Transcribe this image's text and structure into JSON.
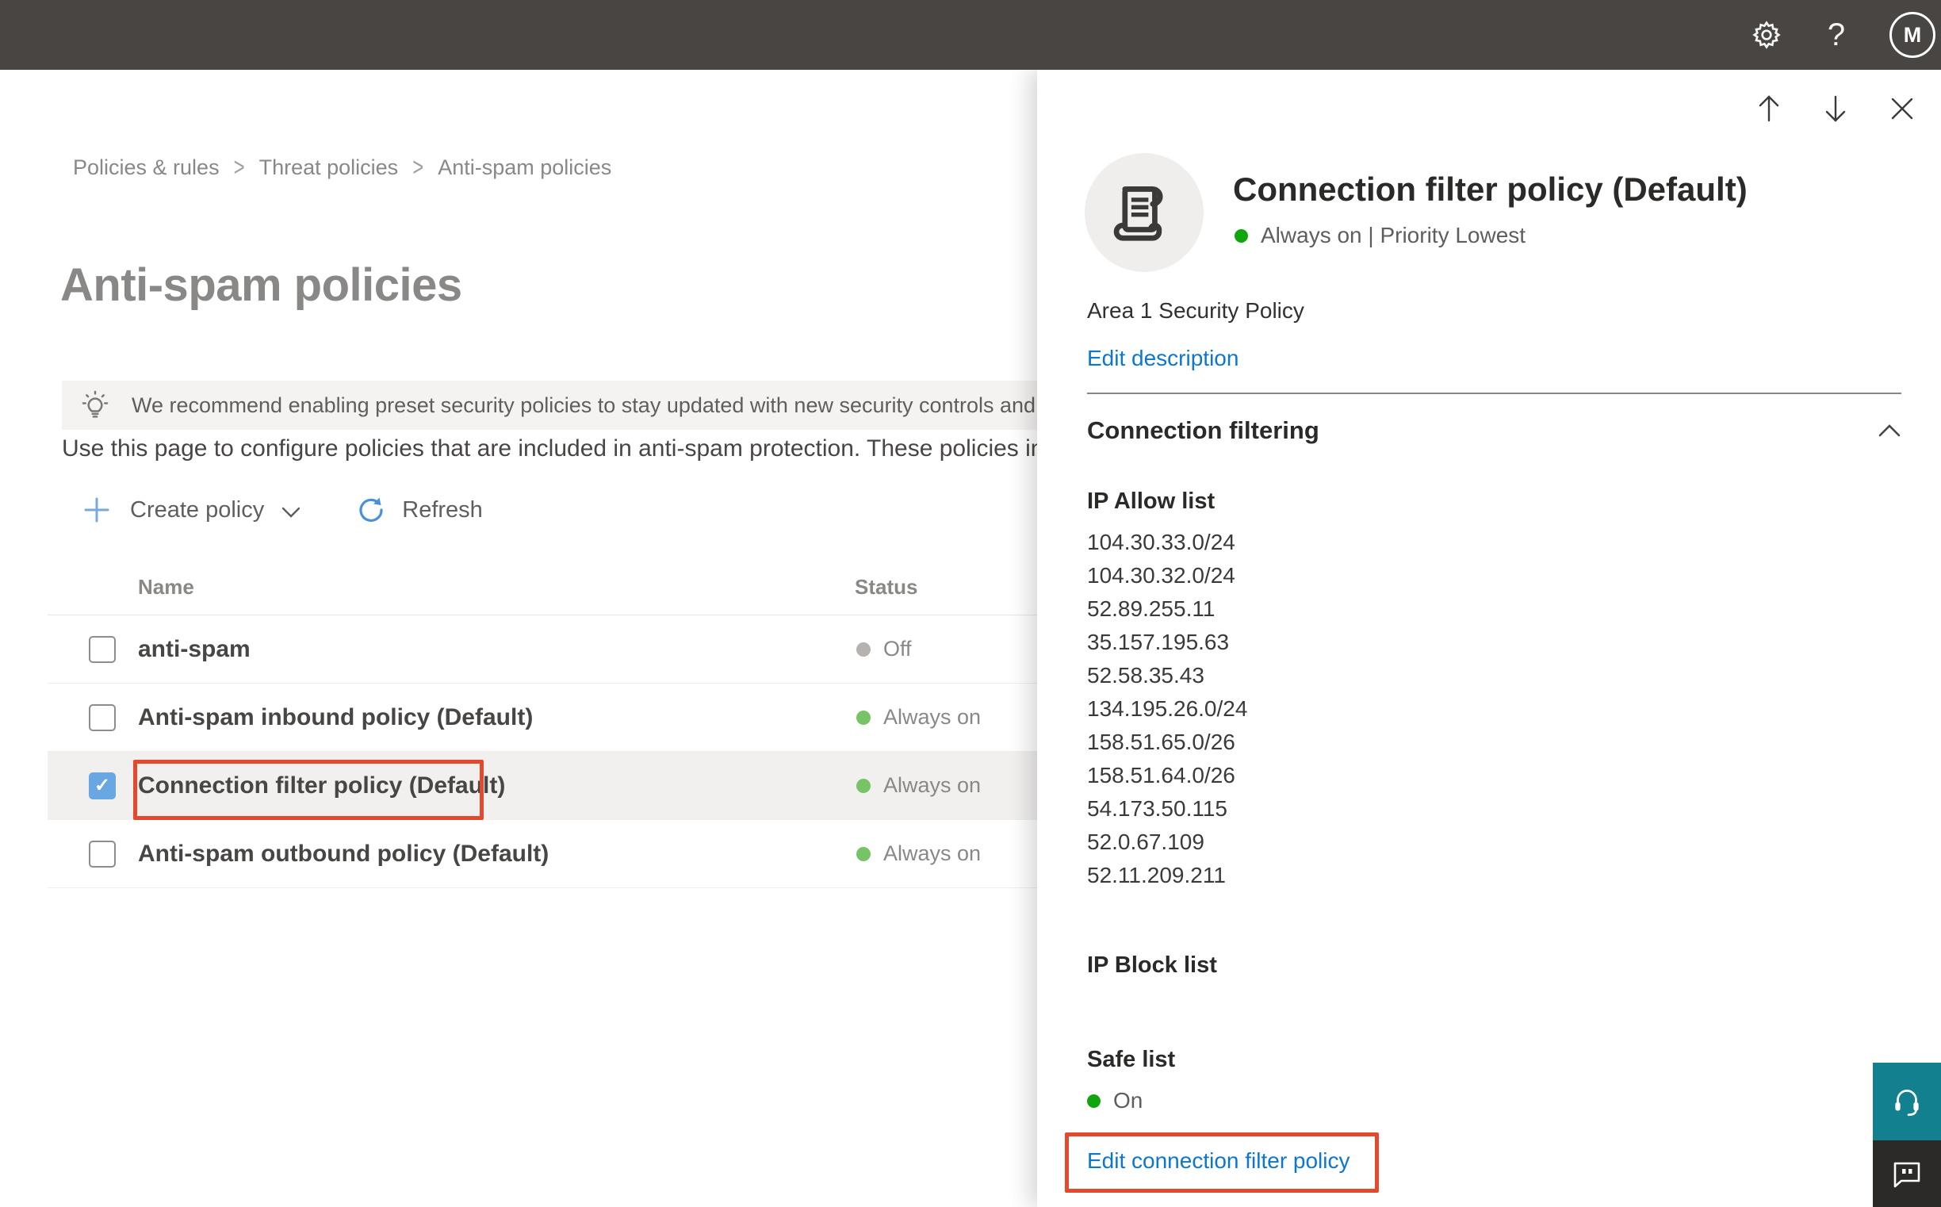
{
  "topbar": {
    "help_label": "?",
    "avatar_initial": "M"
  },
  "breadcrumb": {
    "separator": ">",
    "items": [
      "Policies & rules",
      "Threat policies",
      "Anti-spam policies"
    ]
  },
  "page": {
    "title": "Anti-spam policies",
    "banner_text": "We recommend enabling preset security policies to stay updated with new security controls and our recomme",
    "intro_text": "Use this page to configure policies that are included in anti-spam protection. These policies include"
  },
  "toolbar": {
    "create_label": "Create policy",
    "refresh_label": "Refresh"
  },
  "table": {
    "columns": [
      "Name",
      "Status"
    ],
    "rows": [
      {
        "name": "anti-spam",
        "status": "Off",
        "checked": false
      },
      {
        "name": "Anti-spam inbound policy (Default)",
        "status": "Always on",
        "checked": false
      },
      {
        "name": "Connection filter policy (Default)",
        "status": "Always on",
        "checked": true
      },
      {
        "name": "Anti-spam outbound policy (Default)",
        "status": "Always on",
        "checked": false
      }
    ],
    "checkmark": "✓"
  },
  "panel": {
    "title": "Connection filter policy (Default)",
    "status_line": "Always on | Priority Lowest",
    "description": "Area 1 Security Policy",
    "edit_description_label": "Edit description",
    "section_title": "Connection filtering",
    "ip_allow_label": "IP Allow list",
    "ip_allow": [
      "104.30.33.0/24",
      "104.30.32.0/24",
      "52.89.255.11",
      "35.157.195.63",
      "52.58.35.43",
      "134.195.26.0/24",
      "158.51.65.0/26",
      "158.51.64.0/26",
      "54.173.50.115",
      "52.0.67.109",
      "52.11.209.211"
    ],
    "ip_block_label": "IP Block list",
    "safe_list_label": "Safe list",
    "safe_list_status": "On",
    "edit_link_label": "Edit connection filter policy"
  },
  "colors": {
    "topbar_bg": "#484543",
    "link_blue": "#0b77ce",
    "checkbox_blue": "#69a7e2",
    "annotation_red": "#e5492d",
    "status_green_row": "#76c465",
    "status_green_panel": "#0ea50e",
    "status_gray_off": "#b5b2b0",
    "support_teal": "#12808f",
    "feedback_dark": "#2b2a28",
    "selected_row_bg": "#f1f0ef"
  }
}
